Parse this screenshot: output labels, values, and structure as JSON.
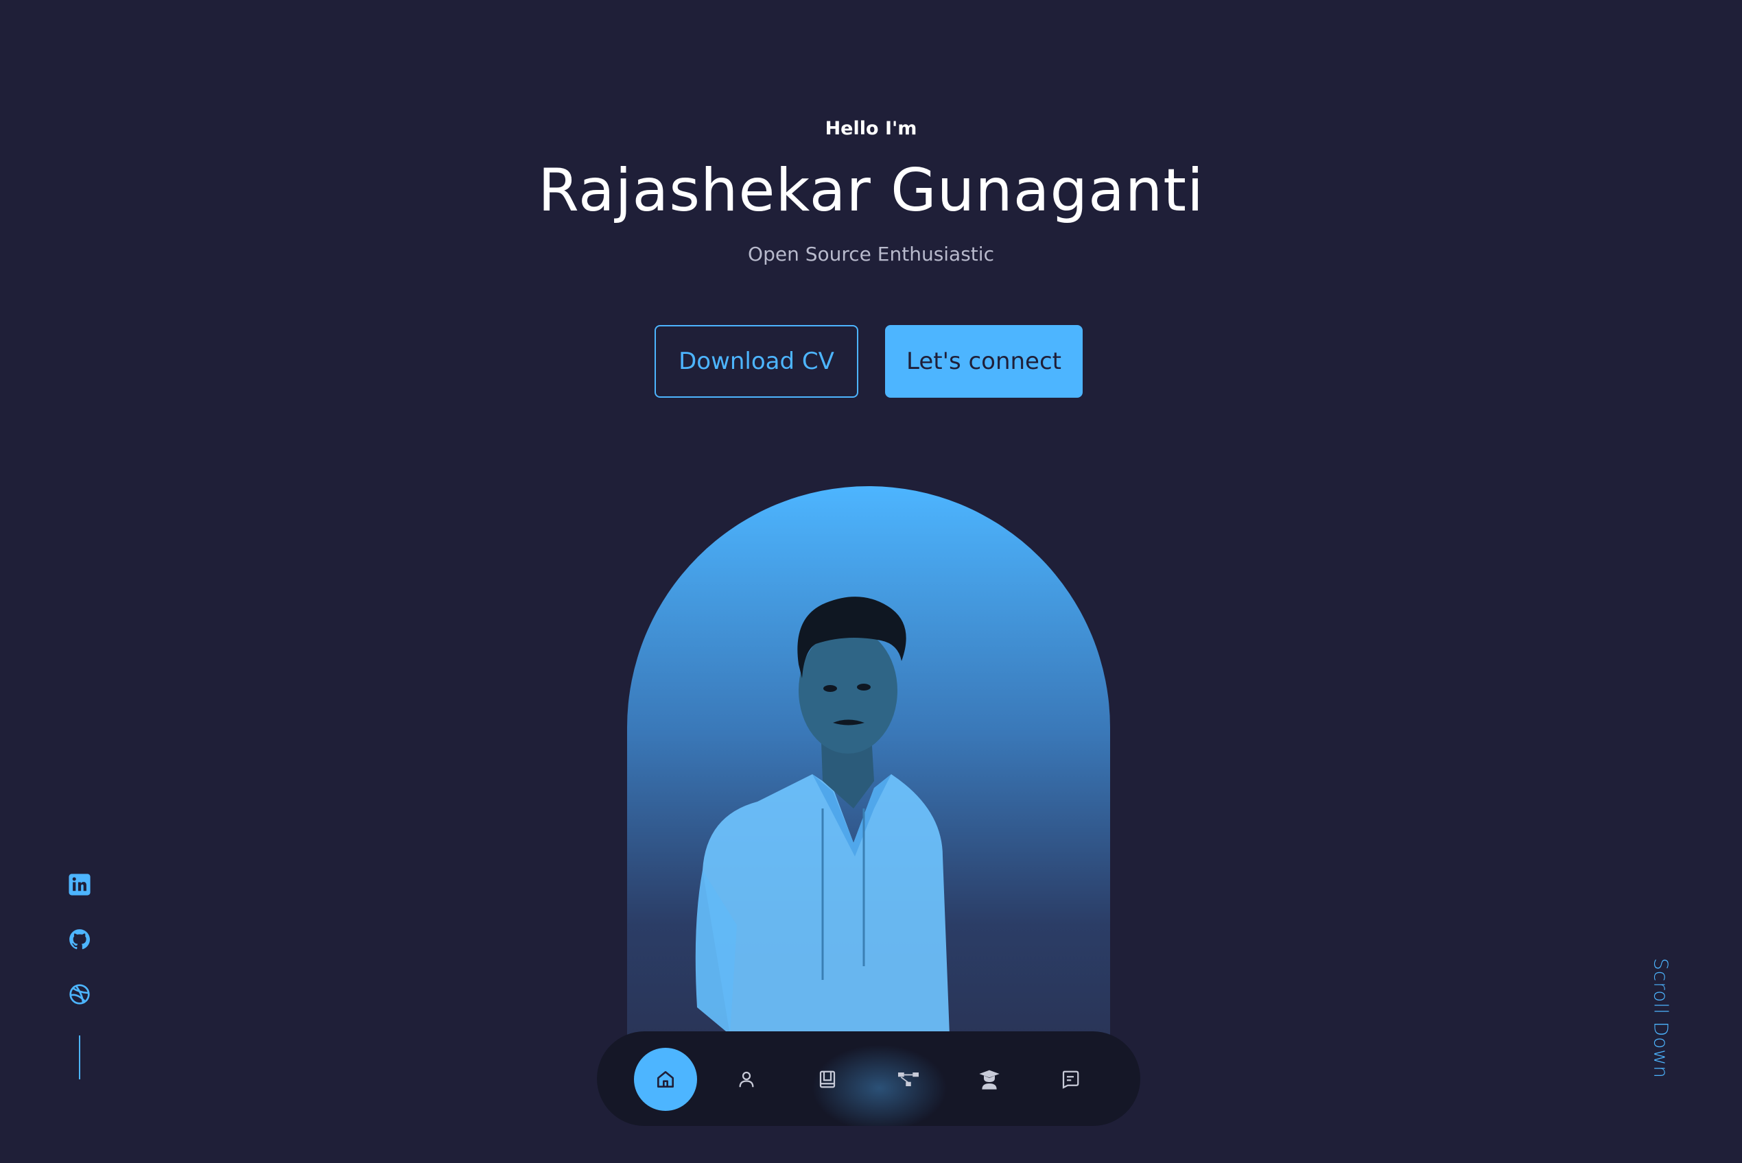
{
  "header": {
    "greeting": "Hello I'm",
    "name": "Rajashekar Gunaganti",
    "tagline": "Open Source Enthusiastic"
  },
  "cta": {
    "download_cv_label": "Download CV",
    "connect_label": "Let's connect"
  },
  "socials": {
    "items": [
      "linkedin-icon",
      "github-icon",
      "dribbble-icon"
    ]
  },
  "scroll": {
    "label": "Scroll Down"
  },
  "nav": {
    "items": [
      {
        "icon": "home-icon",
        "active": true
      },
      {
        "icon": "user-icon",
        "active": false
      },
      {
        "icon": "book-icon",
        "active": false
      },
      {
        "icon": "network-icon",
        "active": false
      },
      {
        "icon": "graduate-icon",
        "active": false
      },
      {
        "icon": "message-icon",
        "active": false
      }
    ]
  },
  "colors": {
    "background": "#1f1f38",
    "accent": "#4db5ff",
    "muted_text": "#b8bacc"
  }
}
